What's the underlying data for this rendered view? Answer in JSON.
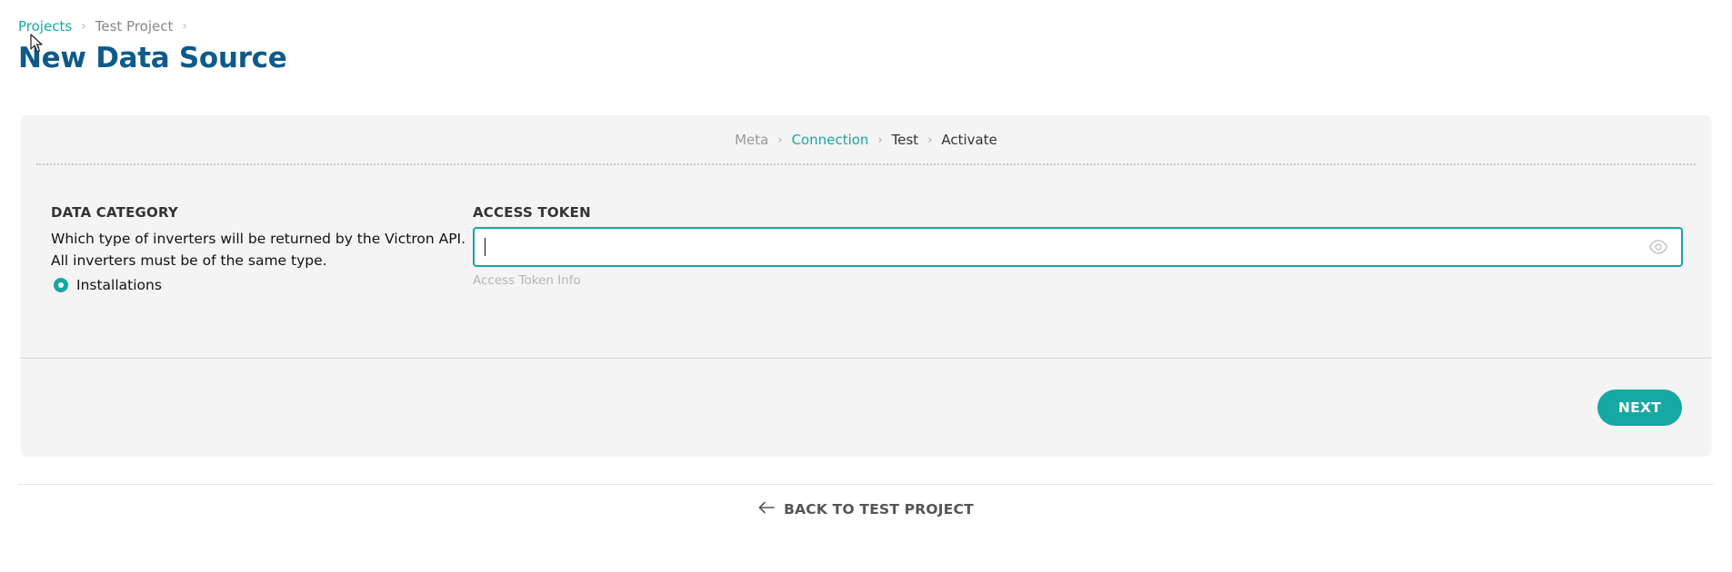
{
  "breadcrumb": {
    "items": [
      {
        "label": "Projects"
      },
      {
        "label": "Test Project"
      }
    ]
  },
  "page": {
    "title": "New Data Source"
  },
  "stepper": {
    "steps": [
      {
        "label": "Meta",
        "state": "done"
      },
      {
        "label": "Connection",
        "state": "active"
      },
      {
        "label": "Test",
        "state": "todo"
      },
      {
        "label": "Activate",
        "state": "todo"
      }
    ]
  },
  "data_category": {
    "label": "DATA CATEGORY",
    "help": "Which type of inverters will be returned by the Victron API. All inverters must be of the same type.",
    "options": [
      {
        "label": "Installations",
        "selected": true
      }
    ]
  },
  "access_token": {
    "label": "ACCESS TOKEN",
    "value": "",
    "hint": "Access Token Info"
  },
  "actions": {
    "next_label": "NEXT",
    "back_label": "BACK TO TEST PROJECT"
  },
  "colors": {
    "accent": "#16a8a3",
    "title": "#0e5a8a",
    "card_background": "#f4f4f4"
  },
  "icons": {
    "breadcrumb_separator": "chevron-right-icon",
    "step_separator": "chevron-right-icon",
    "password_toggle": "eye-icon",
    "back": "arrow-left-icon"
  }
}
